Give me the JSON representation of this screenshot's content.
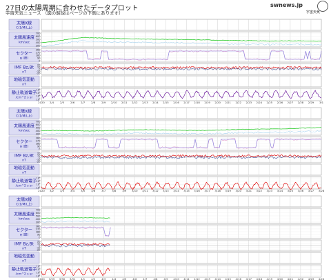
{
  "header": {
    "title": "27日の太陽周期に合わせたデータプロット",
    "subtitle": "宇宙天気ニュース （図の解説はページの下側にあります）",
    "logo_text": "swnews.jp",
    "logo_sub": "宇宙天気"
  },
  "colors": {
    "label_bg": "#dcdcf4",
    "label_border": "#9090b8",
    "label_text": "#1e1ea0",
    "grid": "#c8c8c8",
    "axis": "#000000",
    "solar_wind_speed": "#2ecc2e",
    "solar_wind_speed_alt": "#a8d4f0",
    "sector": "#8080e0",
    "sector_alt": "#e080c0",
    "imf": "#e01010",
    "imf_alt": "#102080",
    "electrons": "#7020a0",
    "electrons_alt": "#e01010"
  },
  "chart_data": [
    {
      "type": "line",
      "title": "",
      "x": [
        "2020",
        "2/4",
        "2/5",
        "2/6",
        "2/7",
        "2/8",
        "2/9",
        "2/10",
        "2/11",
        "2/12",
        "2/13",
        "2/14",
        "2/15",
        "2/16",
        "2/17",
        "2/18",
        "2/19",
        "2/20",
        "2/21",
        "2/22",
        "2/23",
        "2/24",
        "2/25",
        "2/26",
        "2/27",
        "2/28",
        "2/29",
        "3/1"
      ],
      "panels": [
        {
          "label": "太陽X線",
          "unit": "C(1/M/L上)",
          "ticks": []
        },
        {
          "label": "太陽風速度",
          "unit": "km/sec",
          "ticks": [
            "700",
            "600",
            "500",
            "400",
            "300"
          ],
          "series": [
            {
              "name": "",
              "values": [
                390,
                420,
                470,
                520,
                560,
                550,
                540,
                530,
                520,
                515,
                510,
                505,
                500,
                495,
                490,
                485,
                480,
                470,
                465,
                460,
                455,
                450,
                445,
                450,
                455,
                450,
                445,
                440
              ]
            }
          ]
        },
        {
          "label": "セクター",
          "unit": "φ (度)",
          "ticks": [
            "360",
            "270",
            "180",
            "90",
            "0"
          ]
        },
        {
          "label": "IMF Bz,Bt",
          "unit": "nT",
          "ticks": [
            "20",
            "10",
            "0",
            "-10",
            "-20"
          ]
        },
        {
          "label": "地磁気変動",
          "unit": "nT",
          "ticks": []
        },
        {
          "label": "静止軌道電子",
          "unit": "/cm^2 s sr",
          "ticks": [
            "10⁸",
            "10⁶",
            "10⁴",
            "10²"
          ]
        }
      ]
    },
    {
      "type": "line",
      "title": "",
      "x": [
        "2020",
        "3/2",
        "3/3",
        "3/4",
        "3/5",
        "3/6",
        "3/7",
        "3/8",
        "3/9",
        "3/10",
        "3/11",
        "3/12",
        "3/13",
        "3/14",
        "3/15",
        "3/16",
        "3/17",
        "3/18",
        "3/19",
        "3/20",
        "3/21",
        "3/22",
        "3/23",
        "3/24",
        "3/25",
        "3/26",
        "3/27",
        "3/28"
      ],
      "panels": [
        {
          "label": "太陽X線",
          "unit": "C(1/M/L上)",
          "ticks": []
        },
        {
          "label": "太陽風速度",
          "unit": "km/sec",
          "ticks": [
            "700",
            "600",
            "500",
            "400",
            "300"
          ],
          "series": [
            {
              "name": "",
              "values": [
                400,
                410,
                405,
                400,
                395,
                390,
                400,
                410,
                420,
                430,
                430,
                425,
                420,
                415,
                410,
                405,
                415,
                420,
                430,
                440,
                445,
                450,
                455,
                460,
                470,
                480,
                490,
                500
              ]
            }
          ]
        },
        {
          "label": "セクター",
          "unit": "φ (度)",
          "ticks": [
            "360",
            "270",
            "180",
            "90",
            "0"
          ]
        },
        {
          "label": "IMF Bz,Bt",
          "unit": "nT",
          "ticks": [
            "20",
            "10",
            "0",
            "-10",
            "-20"
          ]
        },
        {
          "label": "地磁気変動",
          "unit": "nT",
          "ticks": []
        },
        {
          "label": "静止軌道電子",
          "unit": "/cm^2 s sr",
          "ticks": [
            "10⁸",
            "10⁶",
            "10⁴",
            "10²"
          ]
        }
      ]
    },
    {
      "type": "line",
      "title": "",
      "x": [
        "2020",
        "3/29",
        "3/30",
        "3/31",
        "4/1",
        "4/2",
        "4/3",
        "4/4",
        "4/5",
        "4/6",
        "4/7",
        "4/8",
        "4/9",
        "4/10",
        "4/11",
        "4/12",
        "4/13",
        "4/14",
        "4/15",
        "4/16",
        "4/17",
        "4/18",
        "4/19",
        "4/20",
        "4/21",
        "4/22",
        "4/23",
        "4/24"
      ],
      "panels": [
        {
          "label": "太陽X線",
          "unit": "C(1/M/L上)",
          "ticks": []
        },
        {
          "label": "太陽風速度",
          "unit": "km/sec",
          "ticks": [
            "700",
            "600",
            "500",
            "400",
            "300"
          ],
          "series": [
            {
              "name": "",
              "values": [
                420,
                430,
                440,
                445,
                440,
                435,
                430,
                null,
                null,
                null,
                null,
                null,
                null,
                null,
                null,
                null,
                null,
                null,
                null,
                null,
                null,
                null,
                null,
                null,
                null,
                null,
                null,
                null
              ]
            }
          ]
        },
        {
          "label": "セクター",
          "unit": "φ (度)",
          "ticks": [
            "360",
            "270",
            "180",
            "90",
            "0"
          ]
        },
        {
          "label": "IMF Bz,Bt",
          "unit": "nT",
          "ticks": [
            "20",
            "10",
            "0",
            "-10",
            "-20"
          ]
        },
        {
          "label": "地磁気変動",
          "unit": "nT",
          "ticks": []
        },
        {
          "label": "静止軌道電子",
          "unit": "/cm^2 s sr",
          "ticks": [
            "10⁸",
            "10⁶",
            "10⁴",
            "10²"
          ]
        }
      ]
    }
  ]
}
